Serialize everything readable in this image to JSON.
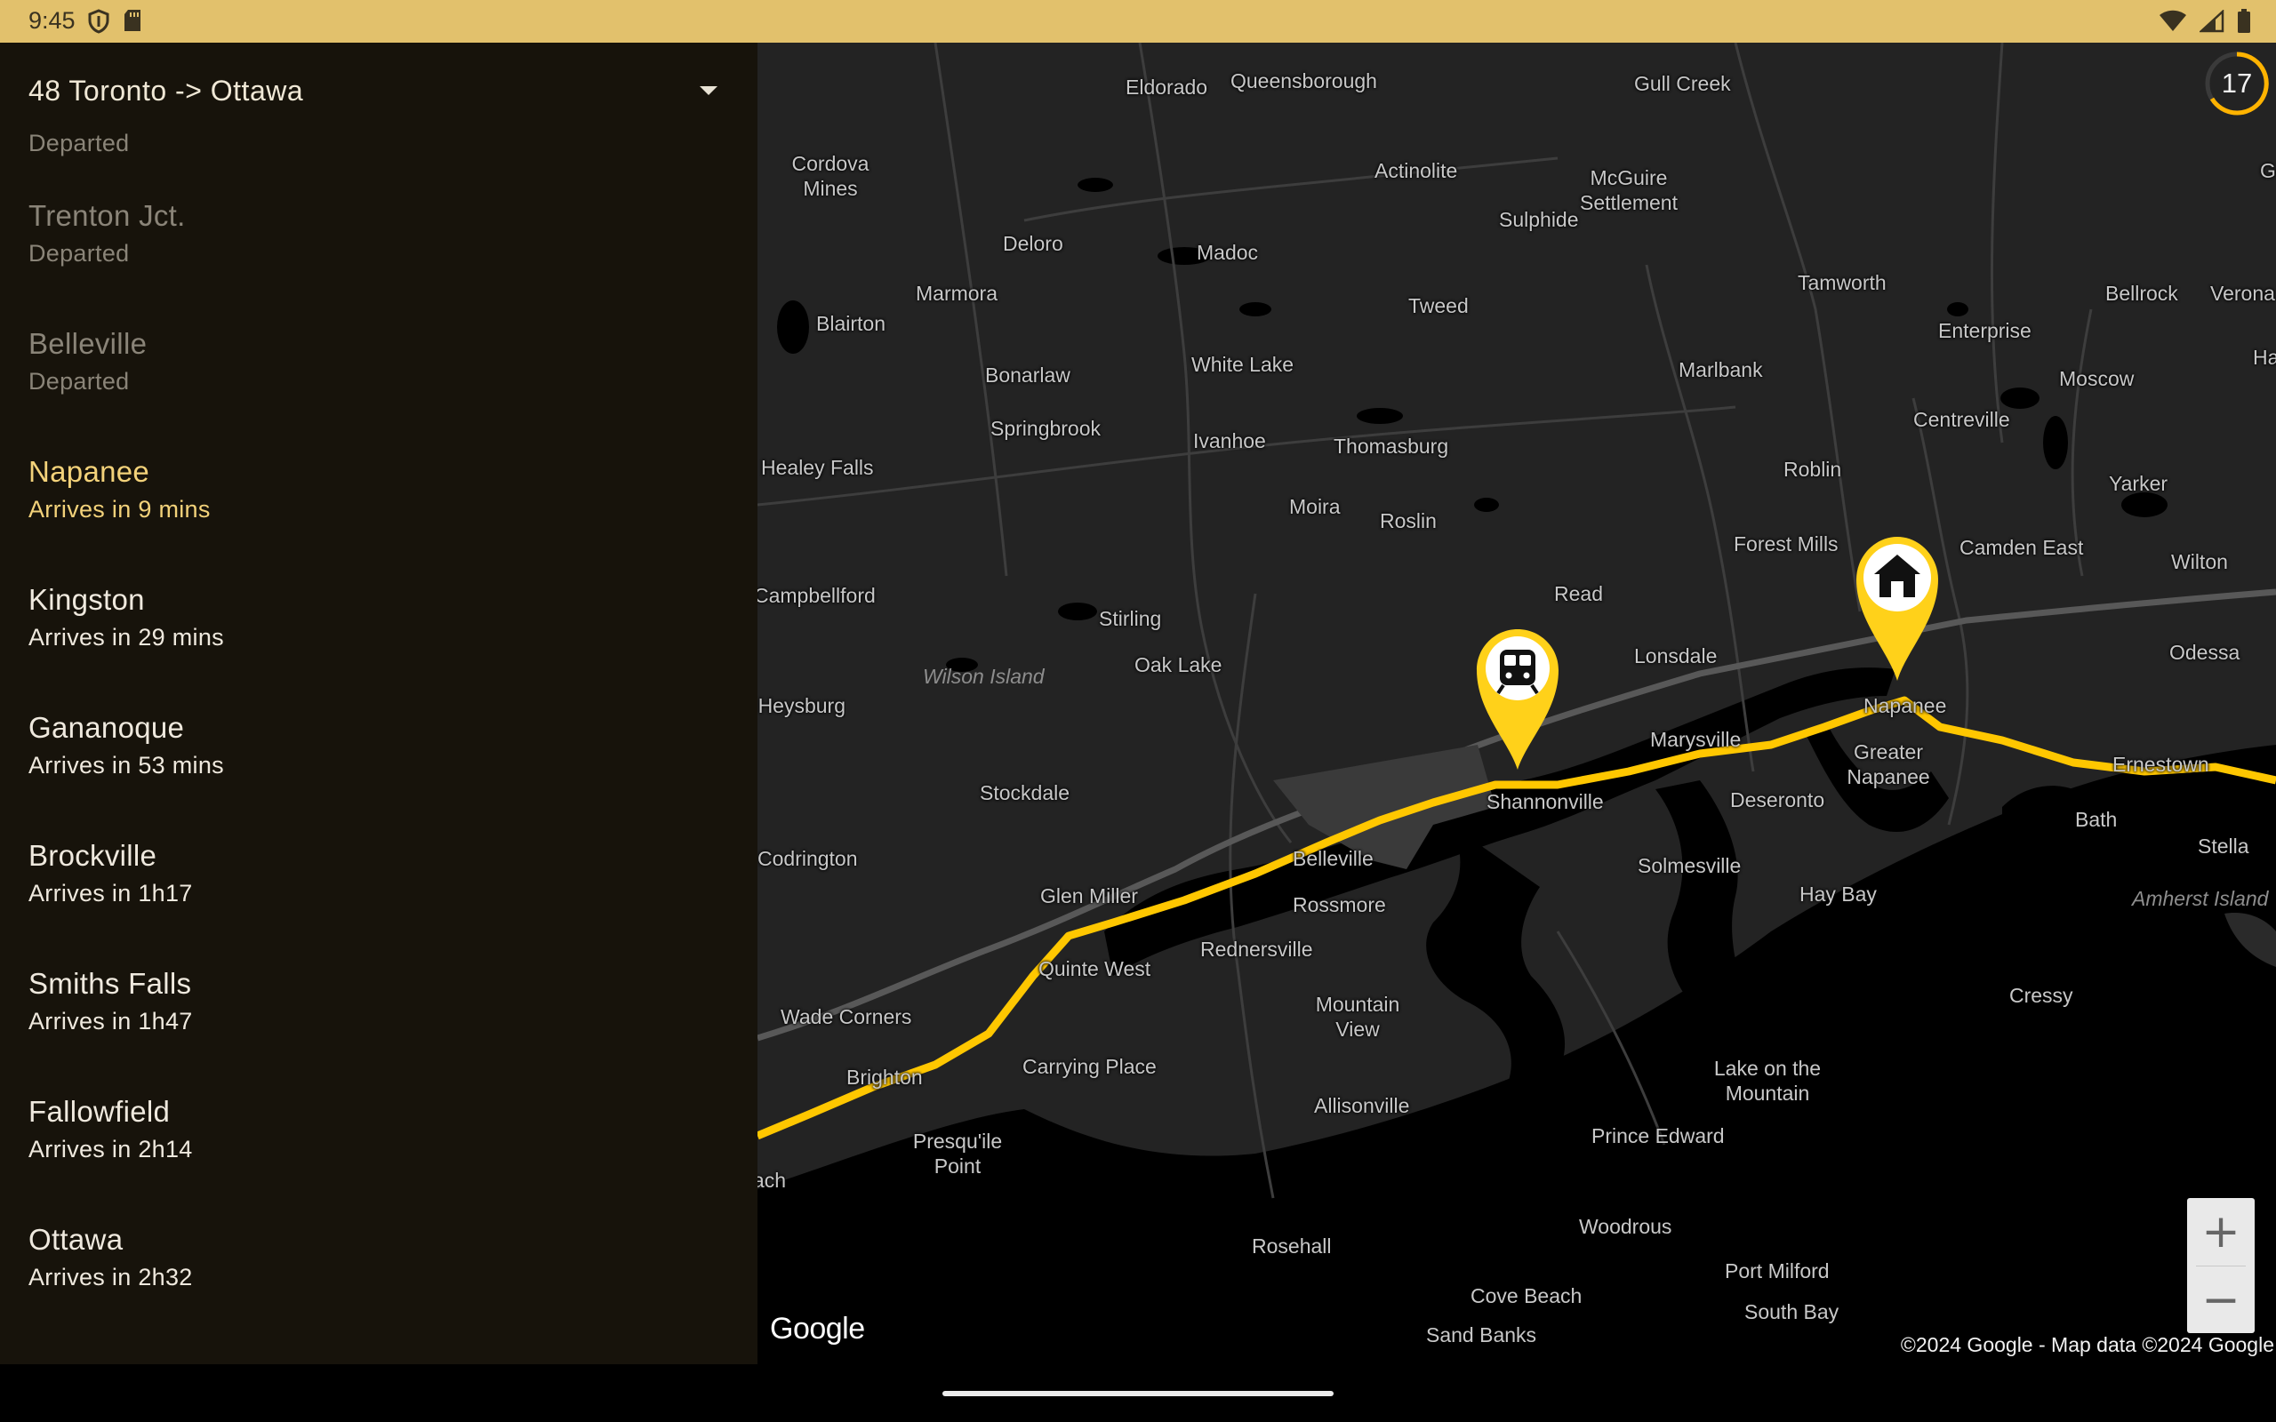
{
  "status_bar": {
    "time": "9:45",
    "left_icons": [
      "shield-icon",
      "sd-card-icon"
    ],
    "right_icons": [
      "wifi-icon",
      "cell-signal-icon",
      "battery-icon"
    ],
    "background": "#e2c16c"
  },
  "header": {
    "route_title": "48 Toronto -> Ottawa",
    "dropdown_icon": "dropdown-arrow-icon"
  },
  "stops": [
    {
      "name": "Trenton Jct.",
      "status": "Departed",
      "state": "past"
    },
    {
      "name": "Belleville",
      "status": "Departed",
      "state": "past"
    },
    {
      "name": "Napanee",
      "status": "Arrives in 9 mins",
      "state": "current"
    },
    {
      "name": "Kingston",
      "status": "Arrives in 29 mins",
      "state": "future"
    },
    {
      "name": "Gananoque",
      "status": "Arrives in 53 mins",
      "state": "future"
    },
    {
      "name": "Brockville",
      "status": "Arrives in 1h17",
      "state": "future"
    },
    {
      "name": "Smiths Falls",
      "status": "Arrives in 1h47",
      "state": "future"
    },
    {
      "name": "Fallowfield",
      "status": "Arrives in 2h14",
      "state": "future"
    },
    {
      "name": "Ottawa",
      "status": "Arrives in 2h32",
      "state": "future"
    }
  ],
  "partial_stop": {
    "status": "Departed"
  },
  "map": {
    "countdown": "17",
    "zoom_in": "+",
    "zoom_out": "−",
    "logo": "Google",
    "attribution": "©2024 Google - Map data ©2024 Google",
    "accent_color": "#ffc107",
    "train_marker_icon": "train-icon",
    "home_marker_icon": "home-icon",
    "places": [
      "Eldorado",
      "Queensborough",
      "Gull Creek",
      "Cordova Mines",
      "Actinolite",
      "McGuire Settlement",
      "Godfrey",
      "Sulphide",
      "Deloro",
      "Madoc",
      "Tamworth",
      "Marmora",
      "Tweed",
      "Bellrock",
      "Verona",
      "Blairton",
      "Enterprise",
      "Harting",
      "White Lake",
      "Bonarlaw",
      "Marlbank",
      "Moscow",
      "Springbrook",
      "Ivanhoe",
      "Centreville",
      "Thomasburg",
      "Healey Falls",
      "Roblin",
      "Yarker",
      "Moira",
      "Roslin",
      "Forest Mills",
      "Camden East",
      "Wilton",
      "Campbellford",
      "Read",
      "Stirling",
      "Lonsdale",
      "Odessa",
      "Oak Lake",
      "Napanee",
      "Seymour Heysburg",
      "Marysville",
      "Greater Napanee",
      "Ernestown",
      "Stockdale",
      "Shannonville",
      "Deseronto",
      "Bath",
      "Stella",
      "Codrington",
      "Belleville",
      "Solmesville",
      "Glen Miller",
      "Hay Bay",
      "Rossmore",
      "Rednersville",
      "Quinte West",
      "Wade Corners",
      "Mountain View",
      "Cressy",
      "Brighton",
      "Carrying Place",
      "Lake on the Mountain",
      "Allisonville",
      "Prince Edward",
      "Presqu'ile Point",
      "Beach",
      "Woodrous",
      "Rosehall",
      "Port Milford",
      "Cove Beach",
      "South Bay",
      "Sand Banks",
      "Wilson Island",
      "Amherst Island"
    ]
  }
}
